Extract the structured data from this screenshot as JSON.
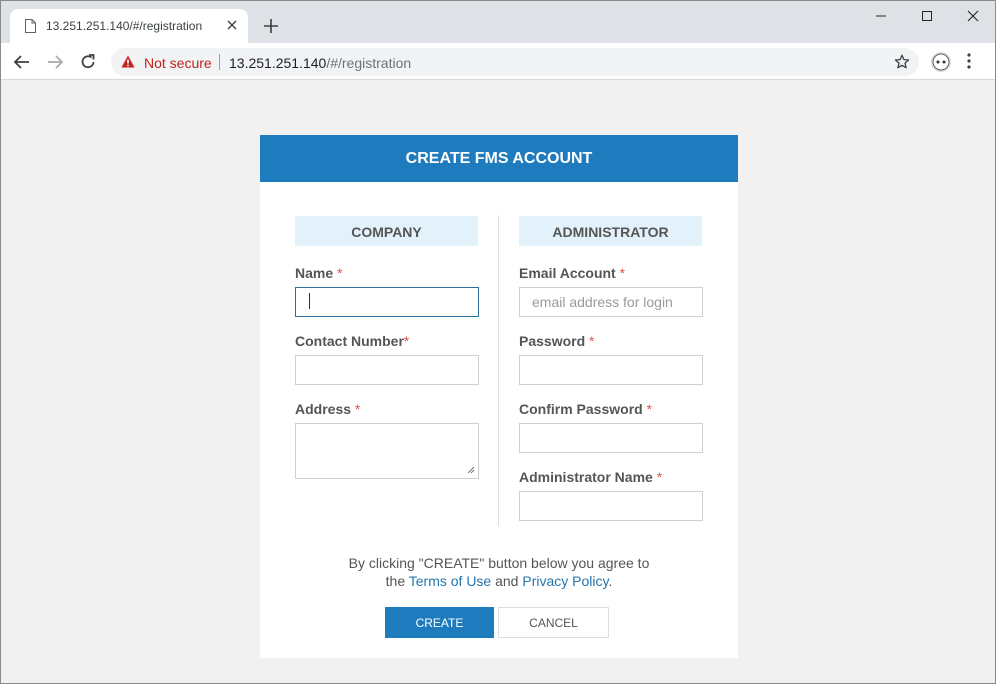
{
  "browser": {
    "tab_title": "13.251.251.140/#/registration",
    "security_label": "Not secure",
    "url_host": "13.251.251.140",
    "url_path": "/#/registration"
  },
  "form": {
    "title": "CREATE FMS ACCOUNT",
    "company": {
      "heading": "COMPANY",
      "name_label": "Name",
      "contact_label": "Contact Number",
      "address_label": "Address"
    },
    "administrator": {
      "heading": "ADMINISTRATOR",
      "email_label": "Email Account",
      "email_placeholder": "email address for login",
      "password_label": "Password",
      "confirm_label": "Confirm Password",
      "admin_name_label": "Administrator Name"
    },
    "required_marker": "*",
    "agreement_line1": "By clicking \"CREATE\" button below you agree to",
    "agreement_the": "the",
    "agreement_terms": "Terms of Use",
    "agreement_and": "and",
    "agreement_privacy": "Privacy Policy",
    "agreement_end": ".",
    "create_label": "CREATE",
    "cancel_label": "CANCEL"
  },
  "colors": {
    "accent": "#1e7bbd",
    "section_bg": "#e2f1fa",
    "required": "#e0524d",
    "warning": "#c5221f"
  },
  "icons": [
    "document-icon",
    "close-icon",
    "plus-icon",
    "minimize-icon",
    "maximize-icon",
    "window-close-icon",
    "back-arrow-icon",
    "forward-arrow-icon",
    "reload-icon",
    "warning-icon",
    "star-icon",
    "profile-icon",
    "menu-icon",
    "resize-grip-icon"
  ]
}
